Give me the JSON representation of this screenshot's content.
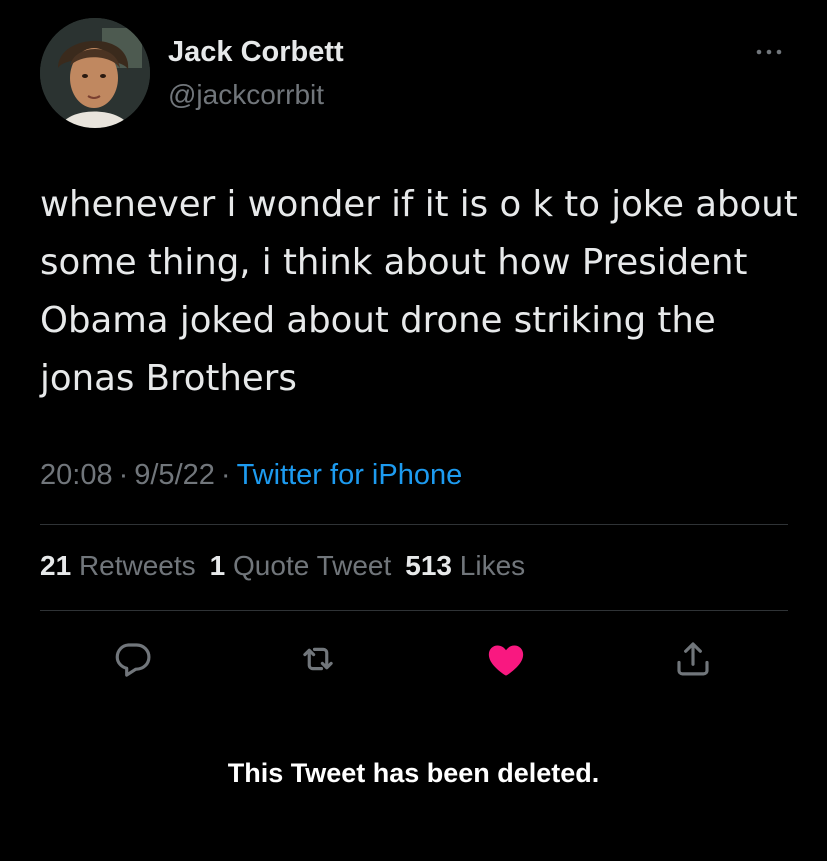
{
  "tweet": {
    "display_name": "Jack Corbett",
    "handle": "@jackcorrbit",
    "text": "whenever i wonder if it is o k to joke about some thing, i think about how President Obama joked about drone striking the jonas Brothers",
    "time": "20:08",
    "date": "9/5/22",
    "source": "Twitter for iPhone",
    "meta_separator": "·"
  },
  "stats": {
    "retweets_count": "21",
    "retweets_label": "Retweets",
    "quotes_count": "1",
    "quotes_label": "Quote Tweet",
    "likes_count": "513",
    "likes_label": "Likes"
  },
  "actions": {
    "reply_icon": "reply-icon",
    "retweet_icon": "retweet-icon",
    "like_icon": "heart-icon",
    "share_icon": "share-icon",
    "liked": true
  },
  "notice": {
    "deleted_text": "This Tweet has been deleted."
  },
  "colors": {
    "background": "#000000",
    "text": "#e7e9ea",
    "muted": "#71767b",
    "link": "#1d9bf0",
    "like": "#f91880",
    "divider": "#2f3336"
  }
}
